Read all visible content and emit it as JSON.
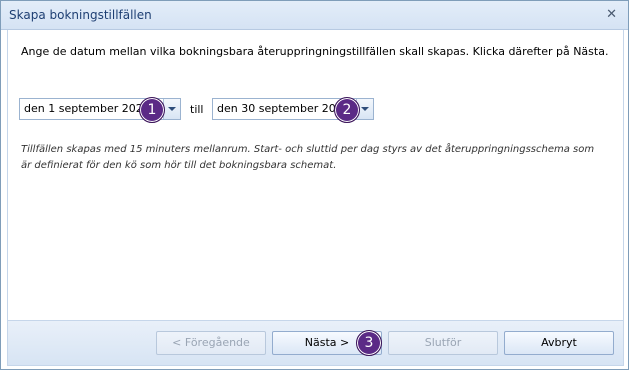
{
  "window": {
    "title": "Skapa bokningstillfällen"
  },
  "content": {
    "instruction": "Ange de datum mellan vilka bokningsbara återuppringningstillfällen skall skapas. Klicka därefter på Nästa.",
    "from_date": "den 1 september 2021",
    "separator": "till",
    "to_date": "den 30 september 2021",
    "note": "Tillfällen skapas med 15 minuters mellanrum. Start- och sluttid per dag styrs av det återuppringningsschema som är definierat för den kö som hör till det bokningsbara schemat."
  },
  "buttons": {
    "previous": "< Föregående",
    "next": "Nästa >",
    "finish": "Slutför",
    "cancel": "Avbryt"
  },
  "callouts": [
    "1",
    "2",
    "3"
  ],
  "colors": {
    "callout": "#5b2a86",
    "title_text": "#1e3f73"
  }
}
